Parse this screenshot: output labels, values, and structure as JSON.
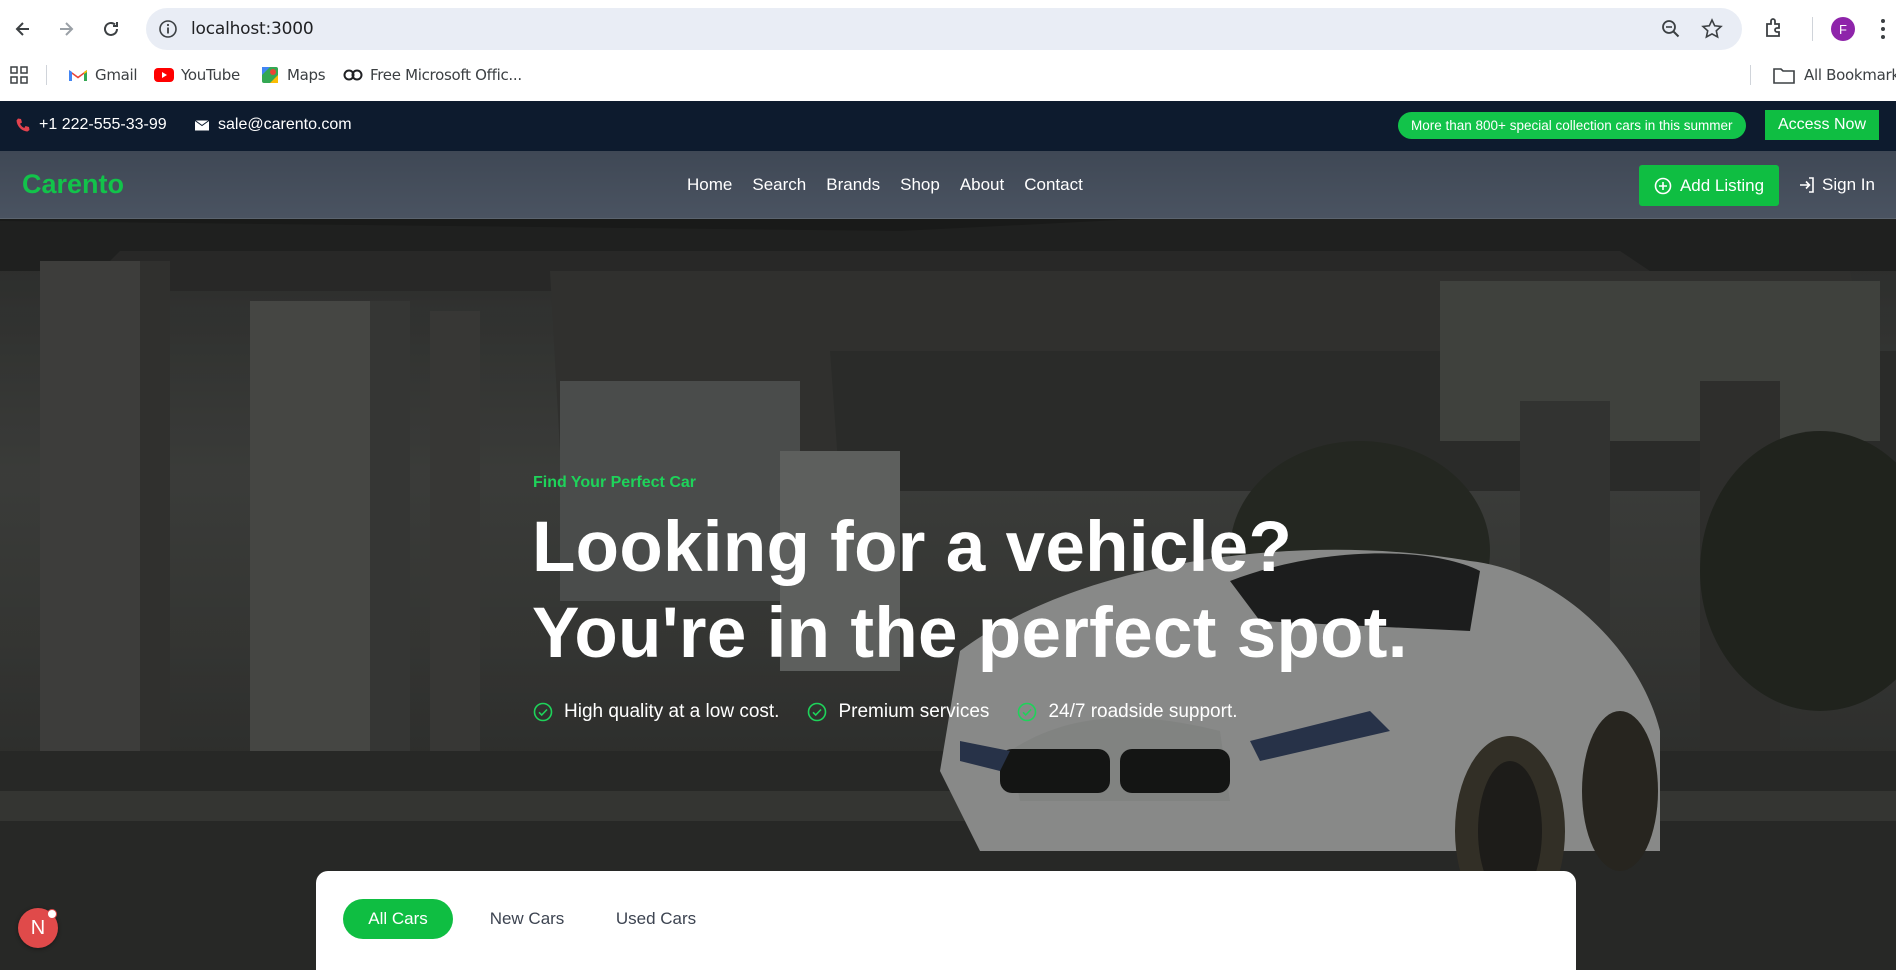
{
  "browser": {
    "url": "localhost:3000",
    "profile_initial": "F",
    "bookmarks": [
      {
        "label": "Gmail",
        "icon": "gmail-icon"
      },
      {
        "label": "YouTube",
        "icon": "youtube-icon"
      },
      {
        "label": "Maps",
        "icon": "maps-icon"
      },
      {
        "label": "Free Microsoft Offic...",
        "icon": "office-icon"
      }
    ],
    "all_bookmarks": "All Bookmarks"
  },
  "topbar": {
    "phone": "+1 222-555-33-99",
    "email": "sale@carento.com",
    "promo": "More than 800+ special collection cars in this summer",
    "access_label": "Access Now"
  },
  "nav": {
    "logo": "Carento",
    "items": [
      "Home",
      "Search",
      "Brands",
      "Shop",
      "About",
      "Contact"
    ],
    "add_listing": "Add Listing",
    "sign_in": "Sign In"
  },
  "hero": {
    "eyebrow": "Find Your Perfect Car",
    "headline_line1": "Looking for a vehicle?",
    "headline_line2": "You're in the perfect spot.",
    "features": [
      "High quality at a low cost.",
      "Premium services",
      "24/7 roadside support."
    ]
  },
  "search_panel": {
    "tabs": [
      "All Cars",
      "New Cars",
      "Used Cars"
    ],
    "active_tab": "All Cars"
  },
  "badge": {
    "letter": "N"
  },
  "colors": {
    "accent": "#0fbe42",
    "topbar_bg": "#0d1b2e",
    "nav_bg": "#444d5a"
  }
}
